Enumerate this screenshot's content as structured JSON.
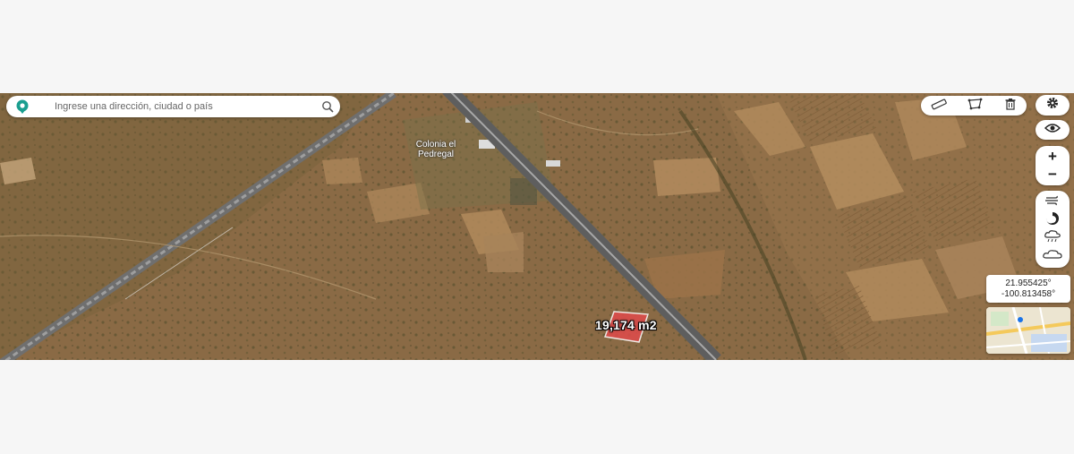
{
  "search": {
    "placeholder": "Ingrese una dirección, ciudad o país",
    "pin_icon": "map-pin-icon",
    "search_icon": "search-icon"
  },
  "toolbar": {
    "icons": [
      "ruler-icon",
      "polygon-icon",
      "trash-icon"
    ]
  },
  "controls": {
    "settings_icon": "gear-icon",
    "view_icon": "eye-icon",
    "zoom_in": "+",
    "zoom_out": "−"
  },
  "layers": [
    "wind-icon",
    "storm-icon",
    "rain-icon",
    "cloud-icon"
  ],
  "coordinates": {
    "lat": "21.955425°",
    "lon": "-100.813458°"
  },
  "map": {
    "place_label": "Colonia el Pedregal",
    "area_label": "19,174 m2",
    "polygon_color": "#e04b4b",
    "accent": "#1a9e8f"
  }
}
